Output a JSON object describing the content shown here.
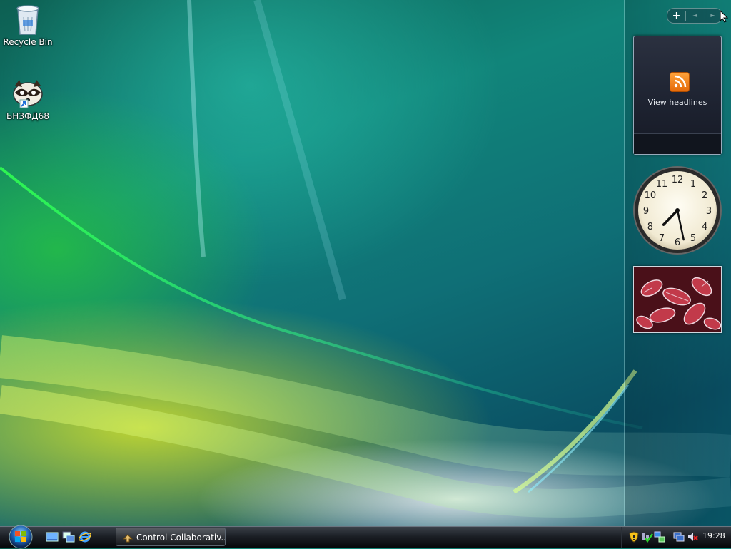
{
  "desktop": {
    "icons": [
      {
        "label": "Recycle Bin",
        "icon": "recycle-bin-icon"
      },
      {
        "label": "ЬНЗФД68",
        "icon": "raccoon-shortcut-icon"
      }
    ]
  },
  "sidebar": {
    "controls": {
      "add": "+",
      "prev": "◄",
      "next": "►"
    },
    "feed_gadget": {
      "label": "View headlines",
      "icon": "rss-feed-icon"
    },
    "clock_gadget": {
      "hour": 7,
      "minute": 28,
      "numerals": [
        "12",
        "1",
        "2",
        "3",
        "4",
        "5",
        "6",
        "7",
        "8",
        "9",
        "10",
        "11"
      ]
    },
    "slideshow_gadget": {
      "icon": "photo-slideshow-icon"
    }
  },
  "taskbar": {
    "start_icon": "windows-start-orb-icon",
    "quick_launch": [
      "show-desktop-icon",
      "switch-windows-icon",
      "internet-explorer-icon"
    ],
    "tasks": [
      {
        "label": "Control Collaborativ...",
        "icon": "app-icon"
      }
    ],
    "tray": {
      "icons": [
        "security-shield-icon",
        "network-check-icon",
        "network-icon",
        "display-icon",
        "volume-muted-icon"
      ],
      "time": "19:28"
    }
  },
  "colors": {
    "taskbar": "#1b1f25",
    "rss_orange": "#f08a1c",
    "wallpaper_teal": "#11857a",
    "wallpaper_green": "#28c83c",
    "wallpaper_yellow": "#dce628"
  }
}
